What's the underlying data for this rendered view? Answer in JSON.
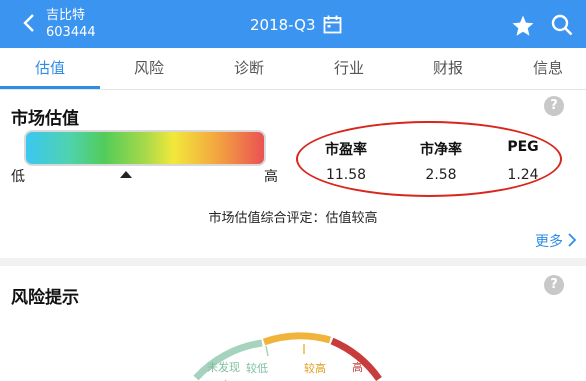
{
  "header": {
    "stock_name": "吉比特",
    "stock_code": "603444",
    "period": "2018-Q3"
  },
  "tabs": [
    {
      "label": "估值",
      "active": true
    },
    {
      "label": "风险",
      "active": false
    },
    {
      "label": "诊断",
      "active": false
    },
    {
      "label": "行业",
      "active": false
    },
    {
      "label": "财报",
      "active": false
    },
    {
      "label": "信息",
      "active": false
    }
  ],
  "valuation": {
    "title": "市场估值",
    "low_label": "低",
    "high_label": "高",
    "marker_position": 0.42,
    "metrics": [
      {
        "name": "市盈率",
        "value": "11.58"
      },
      {
        "name": "市净率",
        "value": "2.58"
      },
      {
        "name": "PEG",
        "value": "1.24"
      }
    ],
    "summary": "市场估值综合评定：估值较高",
    "more": "更多"
  },
  "risk": {
    "title": "风险提示",
    "gauge_labels": [
      "未发现",
      "较低",
      "较高",
      "高"
    ]
  },
  "colors": {
    "header_bg": "#3b95f0",
    "accent": "#2f8ce8",
    "highlight_ellipse": "#d9261c"
  }
}
